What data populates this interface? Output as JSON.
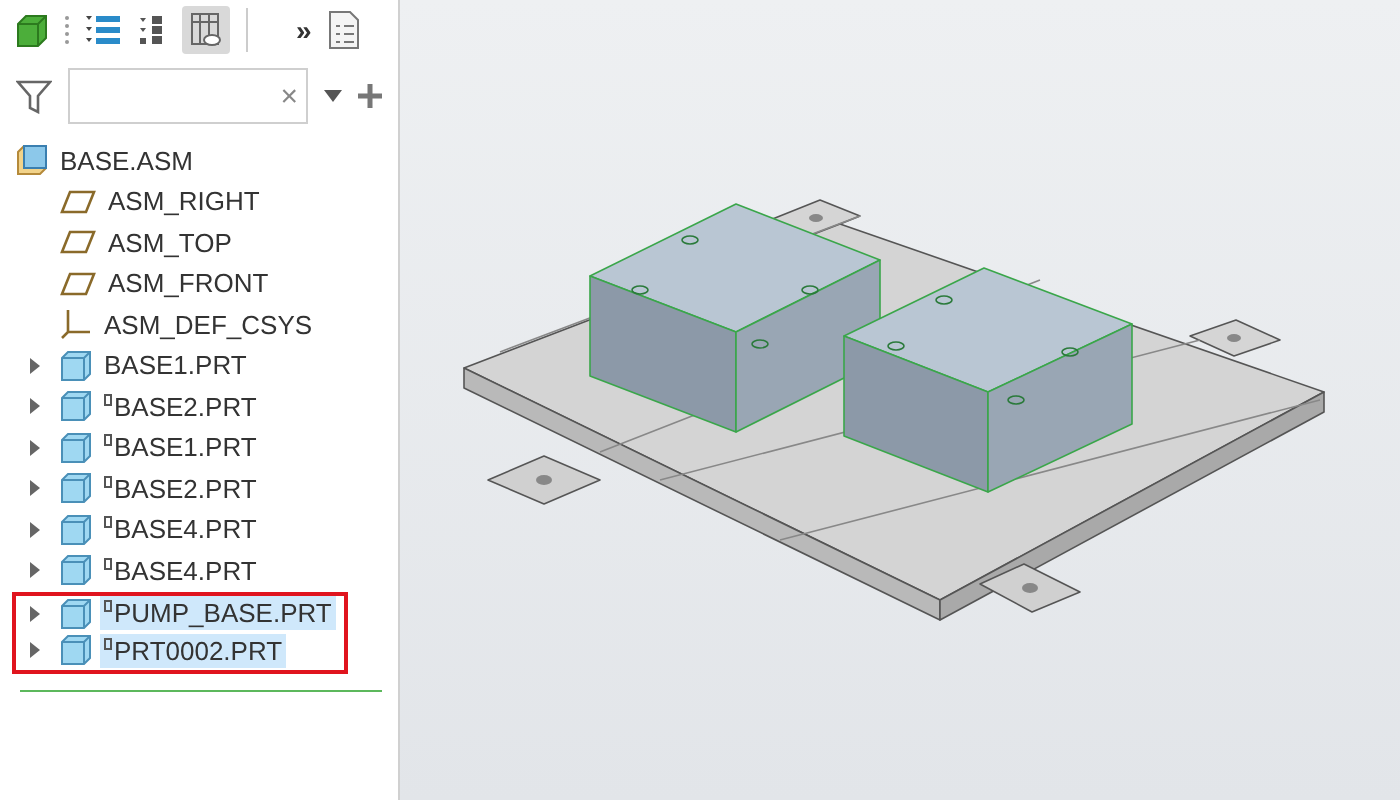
{
  "toolbar": {
    "overflow": "»",
    "columns_view": {
      "selected": true
    }
  },
  "filter": {
    "clear": "×"
  },
  "tree": {
    "label": "BASE.ASM",
    "children": [
      {
        "kind": "datum",
        "label": "ASM_RIGHT"
      },
      {
        "kind": "datum",
        "label": "ASM_TOP"
      },
      {
        "kind": "datum",
        "label": "ASM_FRONT"
      },
      {
        "kind": "csys",
        "label": "ASM_DEF_CSYS"
      },
      {
        "kind": "part",
        "label": "BASE1.PRT",
        "marked": false,
        "expanded": false,
        "selected": false,
        "highlighted": false
      },
      {
        "kind": "part",
        "label": "BASE2.PRT",
        "marked": true,
        "expanded": false,
        "selected": false,
        "highlighted": false
      },
      {
        "kind": "part",
        "label": "BASE1.PRT",
        "marked": true,
        "expanded": false,
        "selected": false,
        "highlighted": false
      },
      {
        "kind": "part",
        "label": "BASE2.PRT",
        "marked": true,
        "expanded": false,
        "selected": false,
        "highlighted": false
      },
      {
        "kind": "part",
        "label": "BASE4.PRT",
        "marked": true,
        "expanded": false,
        "selected": false,
        "highlighted": false
      },
      {
        "kind": "part",
        "label": "BASE4.PRT",
        "marked": true,
        "expanded": false,
        "selected": false,
        "highlighted": false
      },
      {
        "kind": "part",
        "label": "PUMP_BASE.PRT",
        "marked": true,
        "expanded": false,
        "selected": true,
        "highlighted": true
      },
      {
        "kind": "part",
        "label": "PRT0002.PRT",
        "marked": true,
        "expanded": false,
        "selected": true,
        "highlighted": true
      }
    ]
  }
}
